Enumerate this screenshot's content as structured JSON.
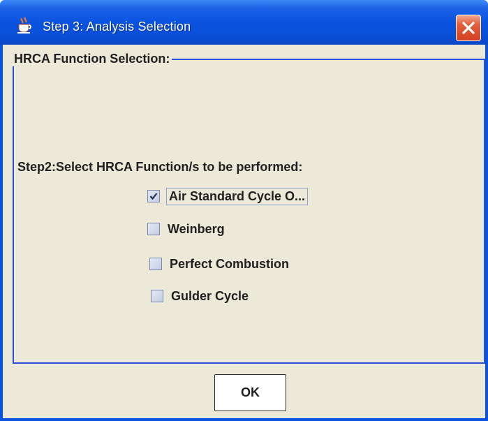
{
  "window": {
    "title": "Step 3: Analysis Selection",
    "title_icon": "java-cup-icon",
    "close_icon": "close-icon",
    "accent_color": "#0a53e0",
    "close_color": "#d2411f"
  },
  "group": {
    "title": "HRCA Function Selection:",
    "prompt": "Step2:Select  HRCA Function/s to be performed:",
    "options": [
      {
        "label": "Air Standard Cycle O...",
        "checked": true
      },
      {
        "label": "Weinberg",
        "checked": false
      },
      {
        "label": "Perfect Combustion",
        "checked": false
      },
      {
        "label": "Gulder Cycle",
        "checked": false
      }
    ]
  },
  "footer": {
    "ok_label": "OK"
  }
}
